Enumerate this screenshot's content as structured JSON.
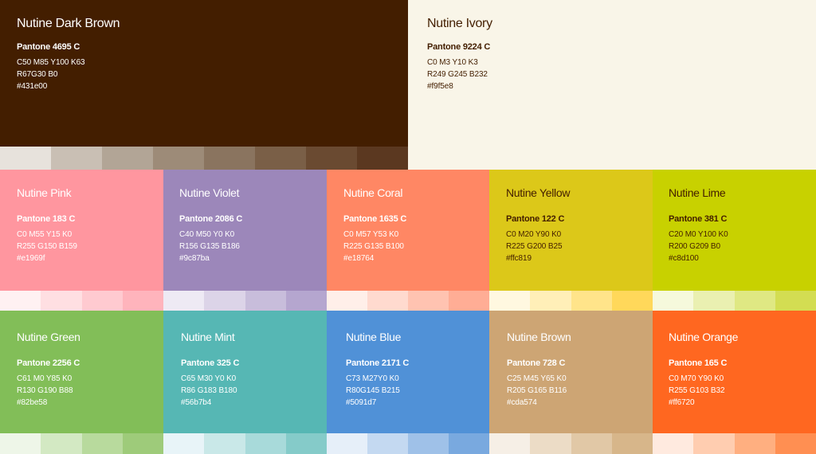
{
  "swatches": [
    {
      "name": "Nutine Dark Brown",
      "pantone": "Pantone 4695 C",
      "cmyk": "C50 M85 Y100 K63",
      "rgb": "R67G30 B0",
      "hex": "#431e00",
      "color": "#431e00",
      "text": "#ffffff",
      "tints": [
        "#e7e2dc",
        "#c9bfb4",
        "#b2a596",
        "#9d8b78",
        "#8a745f",
        "#7a5f47",
        "#6a4a31",
        "#5b3820"
      ]
    },
    {
      "name": "Nutine Ivory",
      "pantone": "Pantone 9224 C",
      "cmyk": "C0 M3 Y10 K3",
      "rgb": "R249 G245 B232",
      "hex": "#f9f5e8",
      "color": "#f9f5e8",
      "text": "#431e00",
      "tints": []
    },
    {
      "name": "Nutine Pink",
      "pantone": "Pantone 183 C",
      "cmyk": "C0 M55 Y15 K0",
      "rgb": "R255 G150 B159",
      "hex": "#e1969f",
      "color": "#ff969f",
      "text": "#ffffff",
      "tints": [
        "#fff1f2",
        "#ffdfe2",
        "#ffcad0",
        "#ffb4bc"
      ]
    },
    {
      "name": "Nutine Violet",
      "pantone": "Pantone 2086 C",
      "cmyk": "C40 M50 Y0 K0",
      "rgb": "R156 G135 B186",
      "hex": "#9c87ba",
      "color": "#9c87ba",
      "text": "#ffffff",
      "tints": [
        "#eeeaf4",
        "#dcd4e8",
        "#c8bddb",
        "#b5a6cf"
      ]
    },
    {
      "name": "Nutine Coral",
      "pantone": "Pantone 1635 C",
      "cmyk": "C0 M57 Y53 K0",
      "rgb": "R225 G135 B100",
      "hex": "#e18764",
      "color": "#ff8764",
      "text": "#ffffff",
      "tints": [
        "#ffefe9",
        "#ffdacf",
        "#ffc3b1",
        "#ffad95"
      ]
    },
    {
      "name": "Nutine Yellow",
      "pantone": "Pantone 122 C",
      "cmyk": "C0 M20 Y90 K0",
      "rgb": "R225 G200 B25",
      "hex": "#ffc819",
      "color": "#dcc819",
      "text": "#431e00",
      "tints": [
        "#fff8e0",
        "#ffefb8",
        "#ffe48a",
        "#ffd85a"
      ]
    },
    {
      "name": "Nutine Lime",
      "pantone": "Pantone 381 C",
      "cmyk": "C20 M0 Y100 K0",
      "rgb": "R200 G209 B0",
      "hex": "#c8d100",
      "color": "#c8d100",
      "text": "#431e00",
      "tints": [
        "#f6f9dc",
        "#eaf0b1",
        "#dfe883",
        "#d3dd52"
      ]
    },
    {
      "name": "Nutine Green",
      "pantone": "Pantone 2256 C",
      "cmyk": "C61 M0 Y85 K0",
      "rgb": "R130 G190 B88",
      "hex": "#82be58",
      "color": "#82be58",
      "text": "#ffffff",
      "tints": [
        "#eef6e8",
        "#d3e9c3",
        "#b8da9d",
        "#9ecb7a"
      ]
    },
    {
      "name": "Nutine Mint",
      "pantone": "Pantone 325 C",
      "cmyk": "C65 M30 Y0 K0",
      "rgb": "R86 G183 B180",
      "hex": "#56b7b4",
      "color": "#56b7b4",
      "text": "#ffffff",
      "tints": [
        "#e8f4f8",
        "#c9e8e8",
        "#a8dada",
        "#85cbc9"
      ]
    },
    {
      "name": "Nutine Blue",
      "pantone": "Pantone 2171 C",
      "cmyk": "C73 M27Y0 K0",
      "rgb": "R80G145 B215",
      "hex": "#5091d7",
      "color": "#5091d7",
      "text": "#ffffff",
      "tints": [
        "#e6eff9",
        "#c4d9f1",
        "#9fc1e8",
        "#79a9df"
      ]
    },
    {
      "name": "Nutine Brown",
      "pantone": "Pantone 728 C",
      "cmyk": "C25 M45 Y65 K0",
      "rgb": "R205 G165 B116",
      "hex": "#cda574",
      "color": "#cda574",
      "text": "#ffffff",
      "tints": [
        "#f6efe6",
        "#ecdcc6",
        "#e1c8a6",
        "#d7b68a"
      ]
    },
    {
      "name": "Nutine Orange",
      "pantone": "Pantone 165 C",
      "cmyk": "C0 M70 Y90 K0",
      "rgb": "R255 G103 B32",
      "hex": "#ff6720",
      "color": "#ff6720",
      "text": "#ffffff",
      "tints": [
        "#ffeadf",
        "#ffcdb0",
        "#ffaf80",
        "#ff8f52"
      ]
    }
  ]
}
